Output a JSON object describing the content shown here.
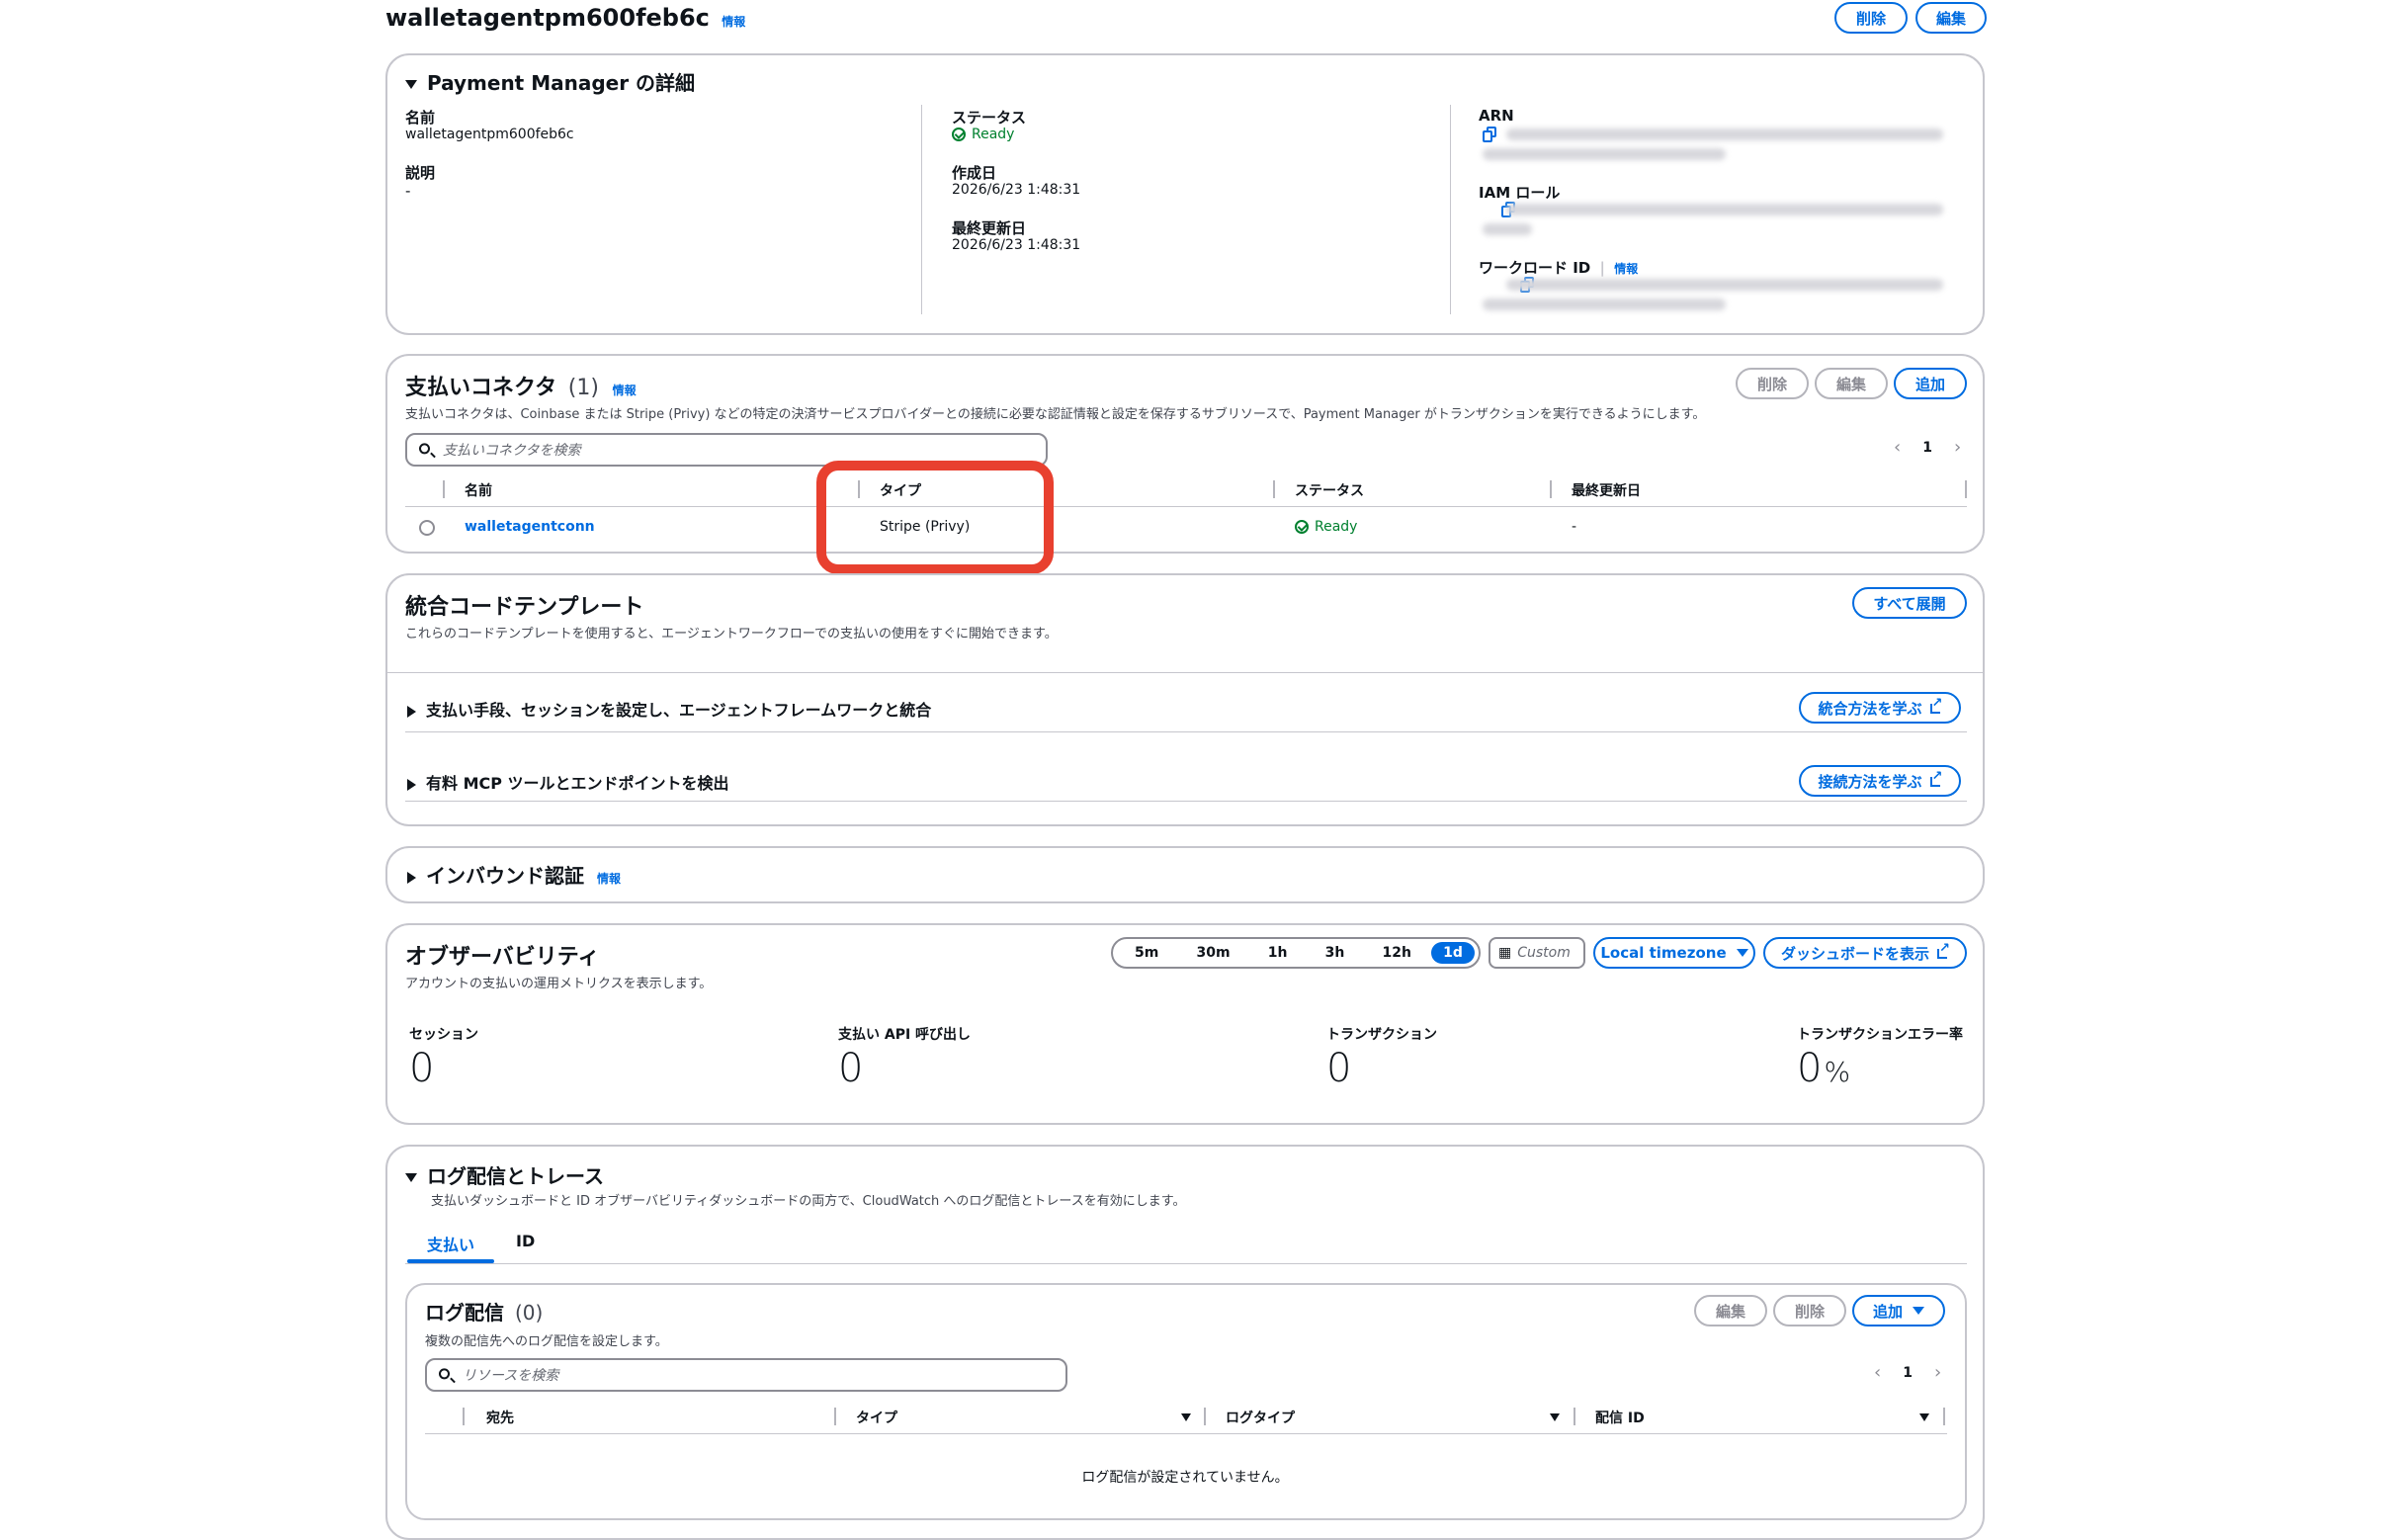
{
  "page": {
    "title": "walletagentpm600feb6c",
    "info": "情報",
    "delete": "削除",
    "edit": "編集"
  },
  "details": {
    "heading": "Payment Manager の詳細",
    "name_label": "名前",
    "name_value": "walletagentpm600feb6c",
    "desc_label": "説明",
    "desc_value": "-",
    "status_label": "ステータス",
    "status_value": "Ready",
    "created_label": "作成日",
    "created_value": "2026/6/23 1:48:31",
    "updated_label": "最終更新日",
    "updated_value": "2026/6/23 1:48:31",
    "arn_label": "ARN",
    "iam_label": "IAM ロール",
    "workload_label": "ワークロード ID",
    "workload_info": "情報"
  },
  "connectors": {
    "title": "支払いコネクタ",
    "count": "(1)",
    "info": "情報",
    "description": "支払いコネクタは、Coinbase または Stripe (Privy) などの特定の決済サービスプロバイダーとの接続に必要な認証情報と設定を保存するサブリソースで、Payment Manager がトランザクションを実行できるようにします。",
    "delete": "削除",
    "edit": "編集",
    "add": "追加",
    "search_placeholder": "支払いコネクタを検索",
    "page": "1",
    "columns": [
      "名前",
      "タイプ",
      "ステータス",
      "最終更新日"
    ],
    "row": {
      "name": "walletagentconn",
      "type": "Stripe (Privy)",
      "status": "Ready",
      "updated": "-"
    }
  },
  "templates": {
    "title": "統合コードテンプレート",
    "description": "これらのコードテンプレートを使用すると、エージェントワークフローでの支払いの使用をすぐに開始できます。",
    "expand_all": "すべて展開",
    "item1": "支払い手段、セッションを設定し、エージェントフレームワークと統合",
    "item1_link": "統合方法を学ぶ",
    "item2": "有料 MCP ツールとエンドポイントを検出",
    "item2_link": "接続方法を学ぶ"
  },
  "inbound": {
    "title": "インバウンド認証",
    "info": "情報"
  },
  "observability": {
    "title": "オブザーバビリティ",
    "description": "アカウントの支払いの運用メトリクスを表示します。",
    "ranges": [
      "5m",
      "30m",
      "1h",
      "3h",
      "12h",
      "1d"
    ],
    "active_range": "1d",
    "custom": "Custom",
    "timezone": "Local timezone",
    "dashboard": "ダッシュボードを表示",
    "metrics": [
      {
        "label": "セッション",
        "value": "0"
      },
      {
        "label": "支払い API 呼び出し",
        "value": "0"
      },
      {
        "label": "トランザクション",
        "value": "0"
      },
      {
        "label": "トランザクションエラー率",
        "value": "0",
        "unit": "%"
      }
    ]
  },
  "logs": {
    "title": "ログ配信とトレース",
    "description": "支払いダッシュボードと ID オブザーバビリティダッシュボードの両方で、CloudWatch へのログ配信とトレースを有効にします。",
    "tabs": [
      "支払い",
      "ID"
    ],
    "delivery_title": "ログ配信",
    "delivery_count": "(0)",
    "delivery_desc": "複数の配信先へのログ配信を設定します。",
    "edit": "編集",
    "delete": "削除",
    "add": "追加",
    "search_placeholder": "リソースを検索",
    "page": "1",
    "columns": [
      "宛先",
      "タイプ",
      "ログタイプ",
      "配信 ID"
    ],
    "empty": "ログ配信が設定されていません。"
  },
  "colors": {
    "accent": "#006ce0",
    "success": "#00802f",
    "highlight": "#e8402f",
    "border": "#c6c6cd"
  }
}
